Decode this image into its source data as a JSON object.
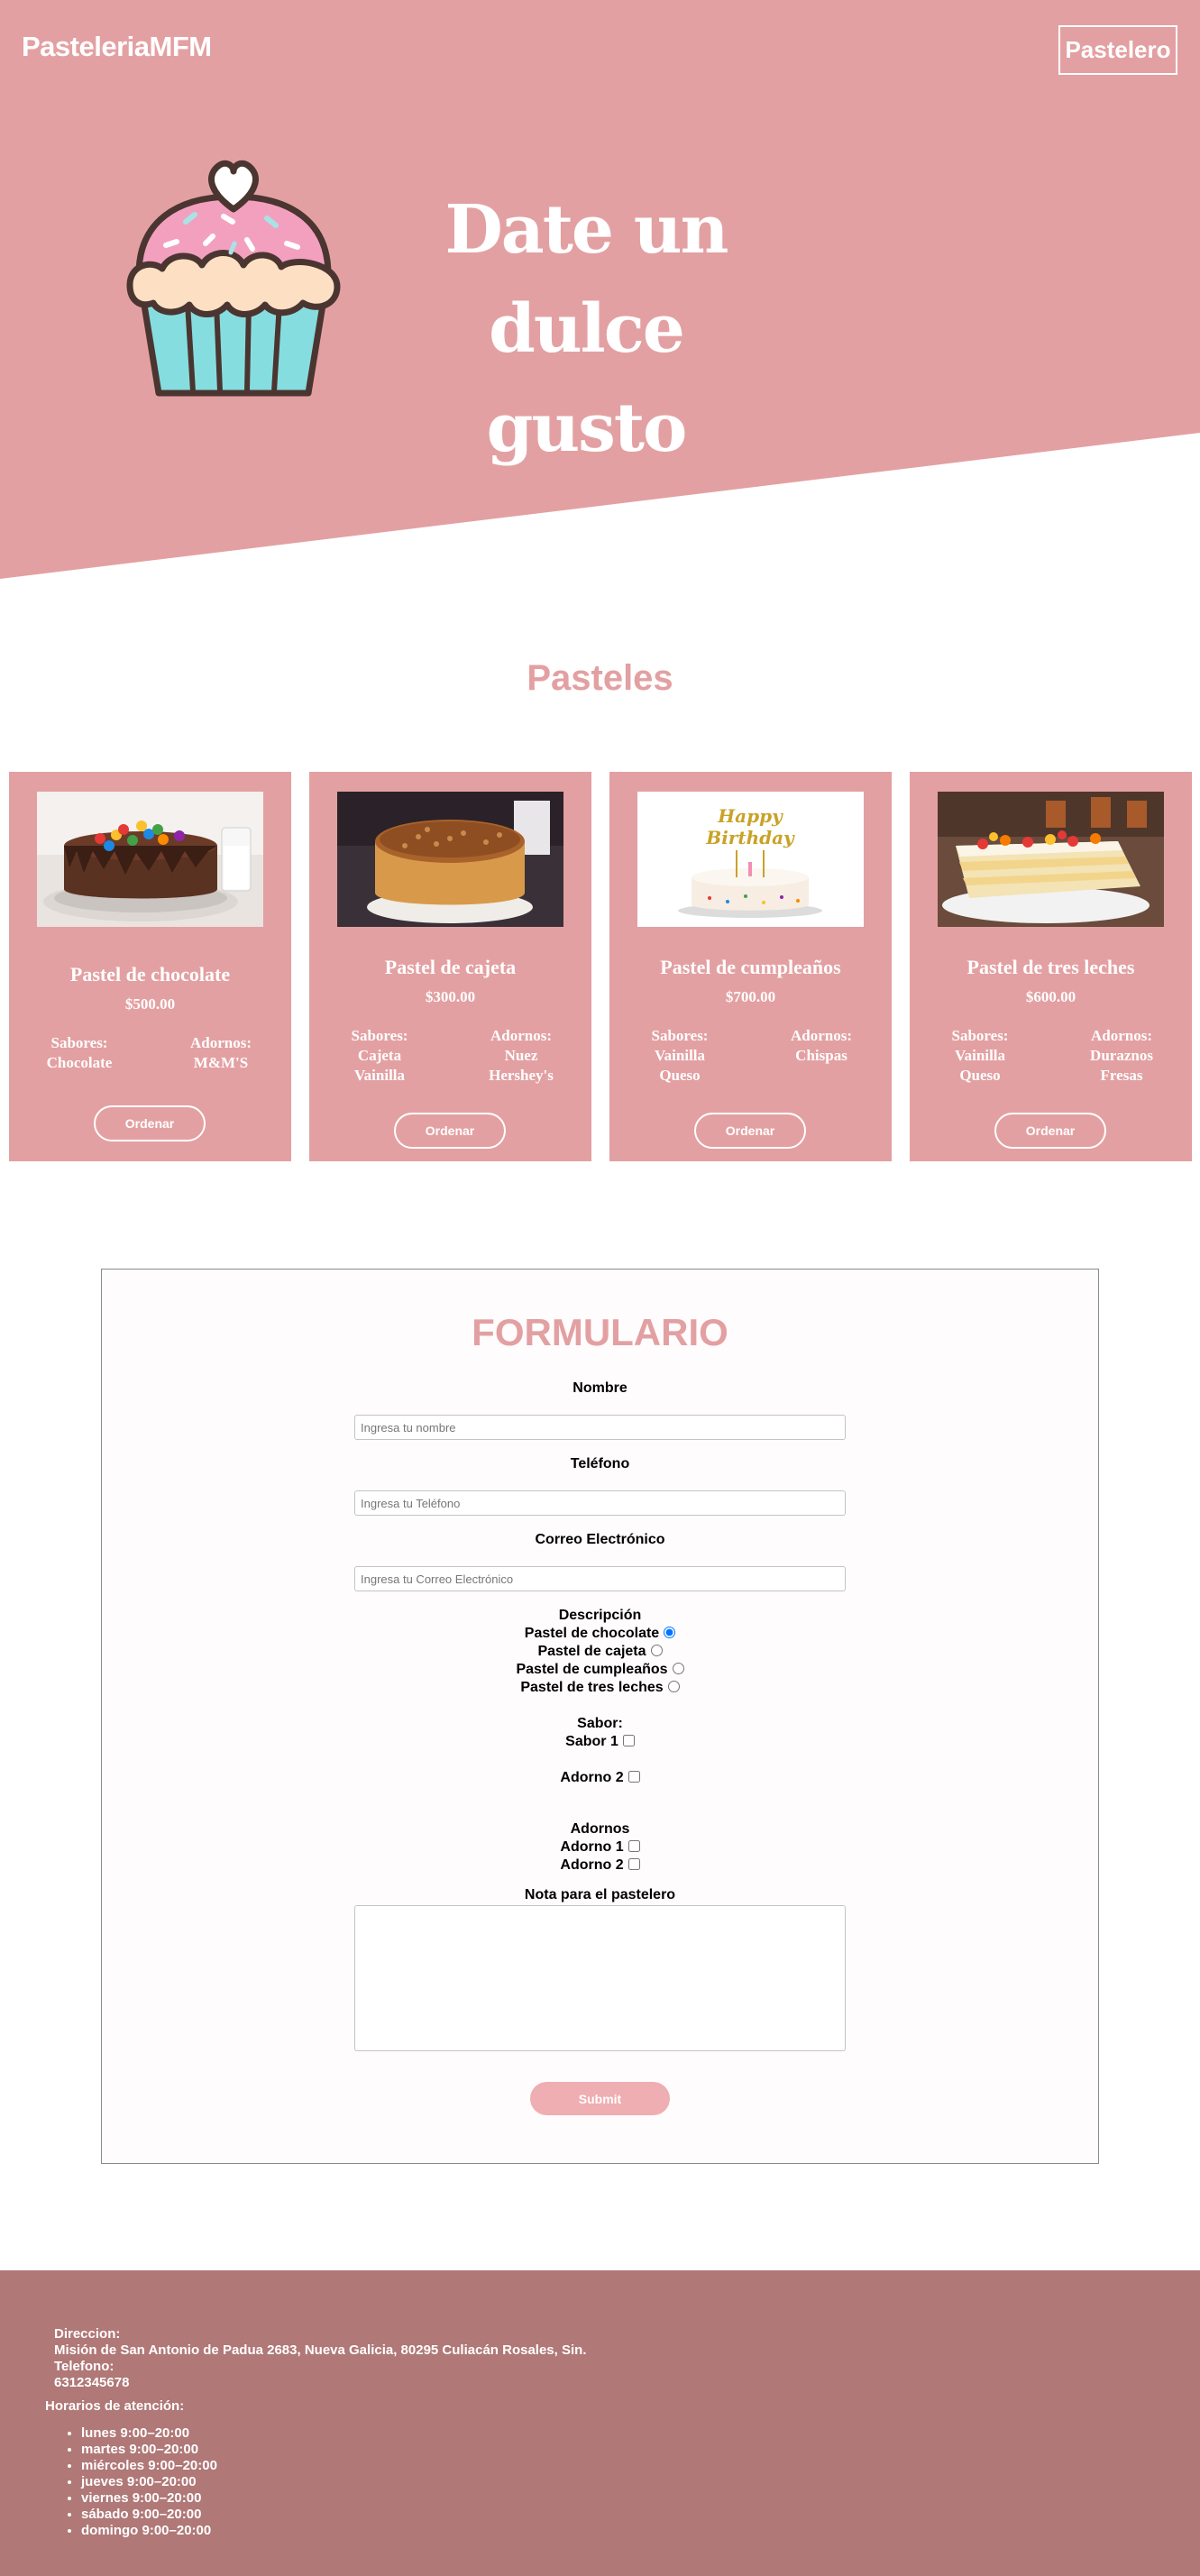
{
  "header": {
    "brand": "PasteleriaMFM",
    "nav_button": "Pastelero"
  },
  "hero": {
    "line1": "Date un",
    "line2": "dulce gusto"
  },
  "section_title": "Pasteles",
  "cakes": [
    {
      "name": "Pastel de chocolate",
      "price": "$500.00",
      "flavors_label": "Sabores:",
      "flavors": [
        "Chocolate"
      ],
      "toppings_label": "Adornos:",
      "toppings": [
        "M&M'S"
      ],
      "button": "Ordenar"
    },
    {
      "name": "Pastel de cajeta",
      "price": "$300.00",
      "flavors_label": "Sabores:",
      "flavors": [
        "Cajeta",
        "Vainilla"
      ],
      "toppings_label": "Adornos:",
      "toppings": [
        "Nuez",
        "Hershey's"
      ],
      "button": "Ordenar"
    },
    {
      "name": "Pastel de cumpleaños",
      "price": "$700.00",
      "flavors_label": "Sabores:",
      "flavors": [
        "Vainilla",
        "Queso"
      ],
      "toppings_label": "Adornos:",
      "toppings": [
        "Chispas"
      ],
      "button": "Ordenar"
    },
    {
      "name": "Pastel de tres leches",
      "price": "$600.00",
      "flavors_label": "Sabores:",
      "flavors": [
        "Vainilla",
        "Queso"
      ],
      "toppings_label": "Adornos:",
      "toppings": [
        "Duraznos",
        "Fresas"
      ],
      "button": "Ordenar"
    }
  ],
  "birthday_topper": {
    "line1": "Happy",
    "line2": "Birthday"
  },
  "form": {
    "title": "FORMULARIO",
    "name_label": "Nombre",
    "name_placeholder": "Ingresa tu nombre",
    "phone_label": "Teléfono",
    "phone_placeholder": "Ingresa tu Teléfono",
    "email_label": "Correo Electrónico",
    "email_placeholder": "Ingresa tu Correo Electrónico",
    "description_label": "Descripción",
    "description_options": [
      "Pastel de chocolate",
      "Pastel de cajeta",
      "Pastel de cumpleaños",
      "Pastel de tres leches"
    ],
    "description_selected": "Pastel de chocolate",
    "flavor_label": "Sabor:",
    "flavor_options": [
      "Sabor 1",
      "Adorno 2"
    ],
    "toppings_label": "Adornos",
    "toppings_options": [
      "Adorno 1",
      "Adorno 2"
    ],
    "note_label": "Nota para el pastelero",
    "submit": "Submit"
  },
  "footer": {
    "address_label": "Direccion:",
    "address": "Misión de San Antonio de Padua 2683, Nueva Galicia, 80295 Culiacán Rosales, Sin.",
    "phone_label": "Telefono:",
    "phone": "6312345678",
    "hours_title": "Horarios de atención:",
    "hours": [
      "lunes 9:00–20:00",
      "martes 9:00–20:00",
      "miércoles 9:00–20:00",
      "jueves 9:00–20:00",
      "viernes 9:00–20:00",
      "sábado 9:00–20:00",
      "domingo 9:00–20:00"
    ]
  },
  "colors": {
    "brand_pink": "#e3a0a2",
    "footer_bg": "#b07877",
    "submit_bg": "#efaeb2"
  }
}
